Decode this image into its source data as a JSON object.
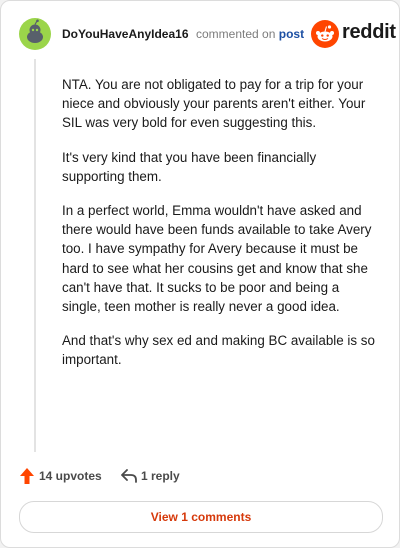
{
  "header": {
    "author": "DoYouHaveAnyIdea16",
    "action_text": "commented on",
    "post_link": "post",
    "logo_text": "reddit"
  },
  "comment": {
    "paragraphs": [
      "NTA. You are not obligated to pay for a trip for your niece and obviously your parents aren't either. Your SIL was very bold for even suggesting this.",
      "It's very kind that you have been financially supporting them.",
      "In a perfect world, Emma wouldn't have asked and there would have been funds available to take Avery too. I have sympathy for Avery because it must be hard to see what her cousins get and know that she can't have that. It sucks to be poor and being a single, teen mother is really never a good idea.",
      "And that's why sex ed and making BC available is so important."
    ]
  },
  "actions": {
    "upvotes_label": "14 upvotes",
    "replies_label": "1 reply",
    "upvote_icon": "upvote-arrow-icon",
    "reply_icon": "reply-arrow-icon"
  },
  "footer": {
    "view_comments_label": "View 1 comments"
  },
  "colors": {
    "accent": "#ff4500",
    "link": "#1c4fa3",
    "avatar_green": "#9bd54a",
    "view_button_text": "#d6390b"
  }
}
